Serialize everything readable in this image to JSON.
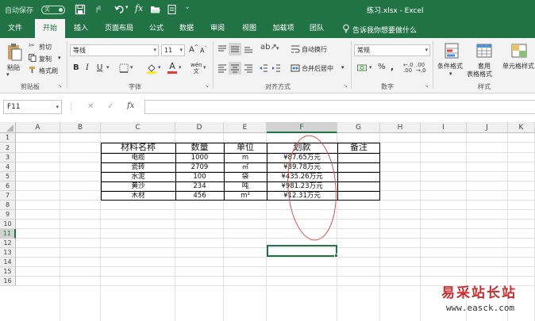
{
  "titlebar": {
    "autosave_label": "自动保存",
    "autosave_state": "关",
    "title": "练习.xlsx  -  Excel"
  },
  "tabs": [
    "文件",
    "开始",
    "插入",
    "页面布局",
    "公式",
    "数据",
    "审阅",
    "视图",
    "加载项",
    "团队"
  ],
  "tell_me": "告诉我你想要做什么",
  "ribbon": {
    "clipboard": {
      "paste": "粘贴",
      "cut": "剪切",
      "copy": "复制",
      "format_painter": "格式刷",
      "group": "剪贴板"
    },
    "font": {
      "name": "等线",
      "size": "11",
      "bold": "B",
      "italic": "I",
      "underline": "U",
      "grow": "A",
      "shrink": "A",
      "wen": "wén",
      "color_letter": "A",
      "group": "字体"
    },
    "alignment": {
      "wrap": "自动换行",
      "merge": "合并后居中",
      "group": "对齐方式"
    },
    "number": {
      "format": "常规",
      "percent": "%",
      "comma": ",",
      "group": "数字"
    },
    "styles": {
      "conditional": "条件格式",
      "table_line1": "套用",
      "table_line2": "表格格式",
      "cell_styles": "单元格样式",
      "group": "样式"
    }
  },
  "formula_bar": {
    "name_box": "F11",
    "fx": "fx",
    "content": ""
  },
  "columns": [
    "A",
    "B",
    "C",
    "D",
    "E",
    "F",
    "G",
    "H",
    "I",
    "J",
    "K"
  ],
  "selected_column": "F",
  "rows": [
    "1",
    "2",
    "3",
    "4",
    "5",
    "6",
    "7",
    "8",
    "9",
    "10",
    "11",
    "12",
    "13",
    "14",
    "15",
    "16"
  ],
  "selected_row": "11",
  "table": {
    "headers": [
      "材料名称",
      "数量",
      "单位",
      "划款",
      "备注"
    ],
    "rows": [
      [
        "电缆",
        "1000",
        "m",
        "¥87.65万元",
        ""
      ],
      [
        "瓷砖",
        "2709",
        "㎡",
        "¥89.78万元",
        ""
      ],
      [
        "水泥",
        "100",
        "袋",
        "¥435.26万元",
        ""
      ],
      [
        "黄沙",
        "234",
        "吨",
        "¥981.23万元",
        ""
      ],
      [
        "木材",
        "456",
        "m³",
        "¥12.31万元",
        ""
      ]
    ]
  },
  "watermark": {
    "cn": "易采站长站",
    "url": "www.easck.com"
  },
  "colors": {
    "excel_green": "#217346",
    "annotation_red": "#d9534f"
  }
}
